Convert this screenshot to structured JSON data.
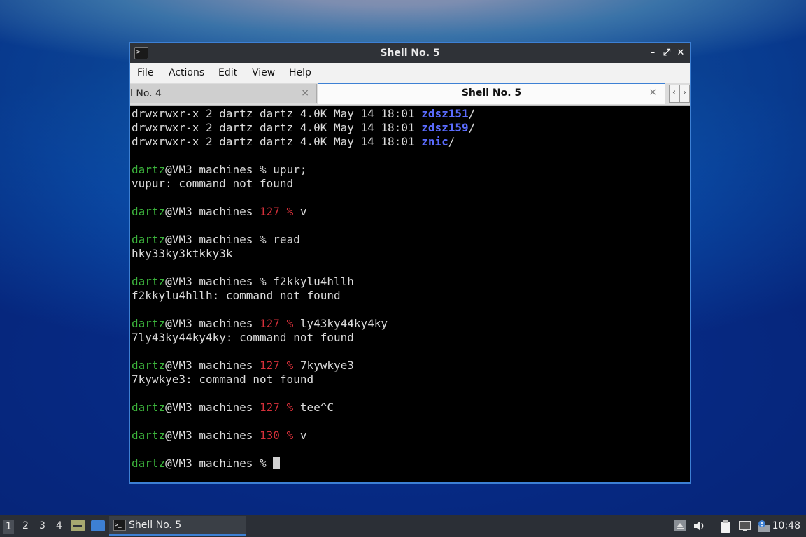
{
  "window": {
    "title": "Shell No. 5",
    "icon": "terminal-icon"
  },
  "menu": [
    "File",
    "Actions",
    "Edit",
    "View",
    "Help"
  ],
  "tabs": {
    "inactive_label": "l No. 4",
    "active_label": "Shell No. 5",
    "close_glyph": "×",
    "scroll_left": "‹",
    "scroll_right": "›"
  },
  "terminal": {
    "lines": [
      [
        {
          "t": "drwxrwxr-x 2 dartz dartz 4.0K May 14 18:01 "
        },
        {
          "t": "zdsz151",
          "c": "blue"
        },
        {
          "t": "/"
        }
      ],
      [
        {
          "t": "drwxrwxr-x 2 dartz dartz 4.0K May 14 18:01 "
        },
        {
          "t": "zdsz159",
          "c": "blue"
        },
        {
          "t": "/"
        }
      ],
      [
        {
          "t": "drwxrwxr-x 2 dartz dartz 4.0K May 14 18:01 "
        },
        {
          "t": "znic",
          "c": "blue"
        },
        {
          "t": "/"
        }
      ],
      [],
      [
        {
          "t": "dartz",
          "c": "green"
        },
        {
          "t": "@VM3 machines % upur;"
        }
      ],
      [
        {
          "t": "vupur: command not found"
        }
      ],
      [],
      [
        {
          "t": "dartz",
          "c": "green"
        },
        {
          "t": "@VM3 machines "
        },
        {
          "t": "127 %",
          "c": "red"
        },
        {
          "t": " v"
        }
      ],
      [],
      [
        {
          "t": "dartz",
          "c": "green"
        },
        {
          "t": "@VM3 machines % read"
        }
      ],
      [
        {
          "t": "hky33ky3ktkky3k"
        }
      ],
      [],
      [
        {
          "t": "dartz",
          "c": "green"
        },
        {
          "t": "@VM3 machines % f2kkylu4hllh"
        }
      ],
      [
        {
          "t": "f2kkylu4hllh: command not found"
        }
      ],
      [],
      [
        {
          "t": "dartz",
          "c": "green"
        },
        {
          "t": "@VM3 machines "
        },
        {
          "t": "127 %",
          "c": "red"
        },
        {
          "t": " ly43ky44ky4ky"
        }
      ],
      [
        {
          "t": "7ly43ky44ky4ky: command not found"
        }
      ],
      [],
      [
        {
          "t": "dartz",
          "c": "green"
        },
        {
          "t": "@VM3 machines "
        },
        {
          "t": "127 %",
          "c": "red"
        },
        {
          "t": " 7kywkye3"
        }
      ],
      [
        {
          "t": "7kywkye3: command not found"
        }
      ],
      [],
      [
        {
          "t": "dartz",
          "c": "green"
        },
        {
          "t": "@VM3 machines "
        },
        {
          "t": "127 %",
          "c": "red"
        },
        {
          "t": " tee^C"
        }
      ],
      [],
      [
        {
          "t": "dartz",
          "c": "green"
        },
        {
          "t": "@VM3 machines "
        },
        {
          "t": "130 %",
          "c": "red"
        },
        {
          "t": " v"
        }
      ],
      [],
      [
        {
          "t": "dartz",
          "c": "green"
        },
        {
          "t": "@VM3 machines % "
        },
        {
          "cursor": true
        }
      ]
    ]
  },
  "taskbar": {
    "workspaces": [
      "1",
      "2",
      "3",
      "4"
    ],
    "active_workspace": "1",
    "task_label": "Shell No. 5",
    "clock": "10:48"
  },
  "colors": {
    "accent": "#3d80d4",
    "green": "#3cb43c",
    "red": "#d6303a",
    "dir_blue": "#5b6cff"
  }
}
